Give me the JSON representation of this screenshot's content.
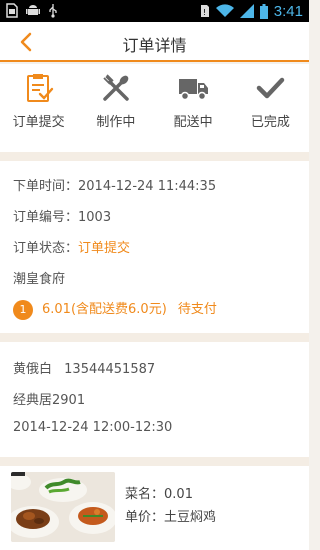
{
  "status_bar": {
    "time": "3:41",
    "icons": [
      "sim-card-icon",
      "android-icon",
      "usb-icon",
      "sim-alert-icon",
      "wifi-icon",
      "signal-icon",
      "battery-icon"
    ]
  },
  "header": {
    "title": "订单详情",
    "back_icon": "chevron-left-icon"
  },
  "steps": [
    {
      "label": "订单提交",
      "icon": "clipboard-check-icon",
      "active": true
    },
    {
      "label": "制作中",
      "icon": "fork-spoon-icon",
      "active": false
    },
    {
      "label": "配送中",
      "icon": "truck-icon",
      "active": false
    },
    {
      "label": "已完成",
      "icon": "checkmark-icon",
      "active": false
    }
  ],
  "order": {
    "time_label": "下单时间：",
    "time_value": "2014-12-24 11:44:35",
    "number_label": "订单编号：",
    "number_value": "1003",
    "status_label": "订单状态：",
    "status_value": "订单提交",
    "restaurant": "潮皇食府",
    "payment_index": "1",
    "payment_amount": "6.01(含配送费6.0元)",
    "payment_status": "待支付"
  },
  "delivery": {
    "name": "黄俄白",
    "phone": "13544451587",
    "address": "经典居2901",
    "time": "2014-12-24 12:00-12:30"
  },
  "dish": {
    "name_label": "菜名：",
    "name_value": "0.01",
    "price_label": "单价：",
    "price_value": "土豆焖鸡",
    "image": "food-photo"
  },
  "colors": {
    "accent": "#f08a1c",
    "icon_gray": "#666666",
    "background": "#f4ede4"
  }
}
